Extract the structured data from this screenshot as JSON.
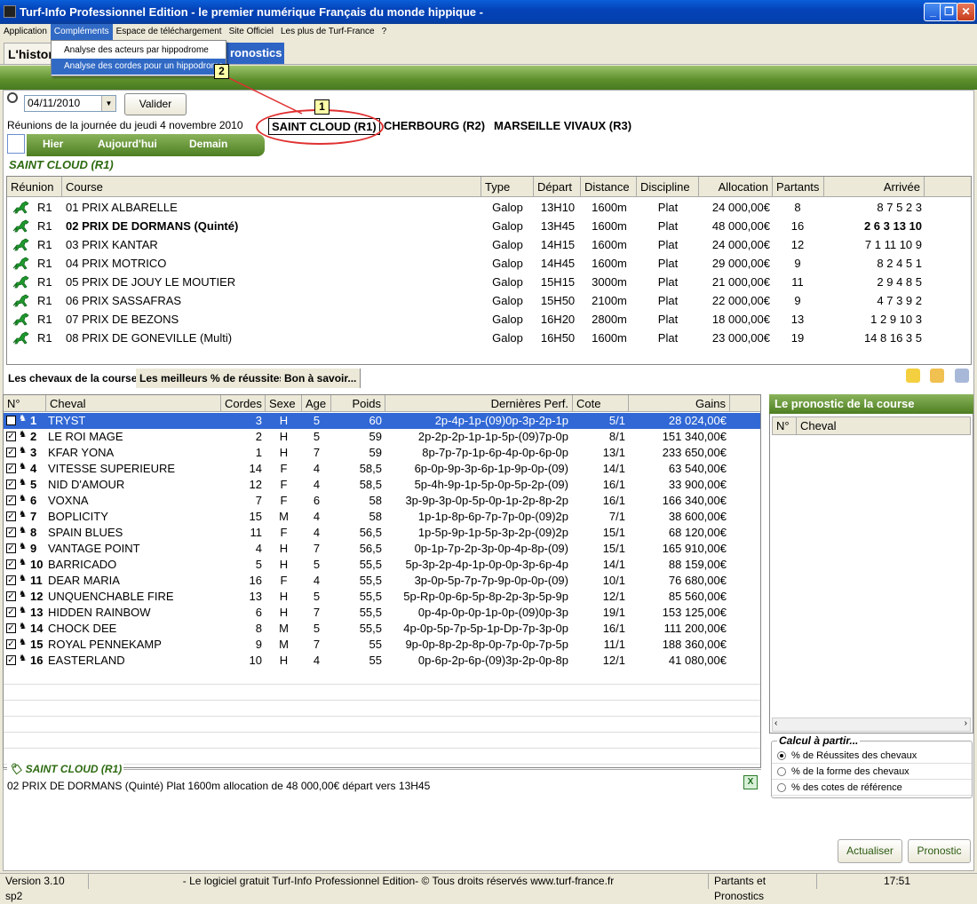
{
  "window": {
    "title": "Turf-Info Professionnel Edition - le premier numérique Français du monde hippique -"
  },
  "menu": [
    "Application",
    "Compléments",
    "Espace de téléchargement",
    "Site Officiel",
    "Les plus de Turf-France",
    "?"
  ],
  "dropdown": [
    "Analyse des acteurs par hippodrome",
    "Analyse des cordes pour un hippodrome"
  ],
  "tabs": {
    "hist": "L'histori",
    "prono": "ronostics"
  },
  "callouts": [
    "1",
    "2"
  ],
  "date": {
    "value": "04/11/2010",
    "valider": "Valider",
    "label": "Réunions de la journée du jeudi 4 novembre 2010"
  },
  "meetings": [
    "SAINT CLOUD (R1)",
    "CHERBOURG (R2)",
    "MARSEILLE VIVAUX (R3)"
  ],
  "daynav": [
    "Hier",
    "Aujourd'hui",
    "Demain"
  ],
  "meeting_title": "SAINT CLOUD (R1)",
  "race_headers": [
    "Réunion",
    "Course",
    "Type",
    "Départ",
    "Distance",
    "Discipline",
    "Allocation",
    "Partants",
    "Arrivée"
  ],
  "races": [
    [
      "R1",
      "01 PRIX ALBARELLE",
      "Galop",
      "13H10",
      "1600m",
      "Plat",
      "24 000,00€",
      "8",
      "8 7 5 2 3"
    ],
    [
      "R1",
      "02 PRIX DE DORMANS (Quinté)",
      "Galop",
      "13H45",
      "1600m",
      "Plat",
      "48 000,00€",
      "16",
      "2 6 3 13 10"
    ],
    [
      "R1",
      "03 PRIX KANTAR",
      "Galop",
      "14H15",
      "1600m",
      "Plat",
      "24 000,00€",
      "12",
      "7 1 11 10 9"
    ],
    [
      "R1",
      "04 PRIX MOTRICO",
      "Galop",
      "14H45",
      "1600m",
      "Plat",
      "29 000,00€",
      "9",
      "8 2 4 5 1"
    ],
    [
      "R1",
      "05 PRIX DE JOUY LE MOUTIER",
      "Galop",
      "15H15",
      "3000m",
      "Plat",
      "21 000,00€",
      "11",
      "2 9 4 8 5"
    ],
    [
      "R1",
      "06 PRIX SASSAFRAS",
      "Galop",
      "15H50",
      "2100m",
      "Plat",
      "22 000,00€",
      "9",
      "4 7 3 9 2"
    ],
    [
      "R1",
      "07 PRIX DE BEZONS",
      "Galop",
      "16H20",
      "2800m",
      "Plat",
      "18 000,00€",
      "13",
      "1 2 9 10 3"
    ],
    [
      "R1",
      "08 PRIX DE GONEVILLE (Multi)",
      "Galop",
      "16H50",
      "1600m",
      "Plat",
      "23 000,00€",
      "19",
      "14 8 16 3 5"
    ]
  ],
  "subtabs": [
    "Les chevaux de la course",
    "Les meilleurs % de réussites",
    "Bon à savoir..."
  ],
  "horse_headers": [
    "N°",
    "Cheval",
    "Cordes",
    "Sexe",
    "Age",
    "Poids",
    "Dernières Perf.",
    "Cote Ref.",
    "Gains"
  ],
  "horses": [
    [
      "1",
      "TRYST",
      "3",
      "H",
      "5",
      "60",
      "2p-4p-1p-(09)0p-3p-2p-1p",
      "5/1",
      "28 024,00€"
    ],
    [
      "2",
      "LE ROI MAGE",
      "2",
      "H",
      "5",
      "59",
      "2p-2p-2p-1p-1p-5p-(09)7p-0p",
      "8/1",
      "151 340,00€"
    ],
    [
      "3",
      "KFAR YONA",
      "1",
      "H",
      "7",
      "59",
      "8p-7p-7p-1p-6p-4p-0p-6p-0p",
      "13/1",
      "233 650,00€"
    ],
    [
      "4",
      "VITESSE SUPERIEURE",
      "14",
      "F",
      "4",
      "58,5",
      "6p-0p-9p-3p-6p-1p-9p-0p-(09)",
      "14/1",
      "63 540,00€"
    ],
    [
      "5",
      "NID D'AMOUR",
      "12",
      "F",
      "4",
      "58,5",
      "5p-4h-9p-1p-5p-0p-5p-2p-(09)",
      "16/1",
      "33 900,00€"
    ],
    [
      "6",
      "VOXNA",
      "7",
      "F",
      "6",
      "58",
      "3p-9p-3p-0p-5p-0p-1p-2p-8p-2p",
      "16/1",
      "166 340,00€"
    ],
    [
      "7",
      "BOPLICITY",
      "15",
      "M",
      "4",
      "58",
      "1p-1p-8p-6p-7p-7p-0p-(09)2p",
      "7/1",
      "38 600,00€"
    ],
    [
      "8",
      "SPAIN BLUES",
      "11",
      "F",
      "4",
      "56,5",
      "1p-5p-9p-1p-5p-3p-2p-(09)2p",
      "15/1",
      "68 120,00€"
    ],
    [
      "9",
      "VANTAGE POINT",
      "4",
      "H",
      "7",
      "56,5",
      "0p-1p-7p-2p-3p-0p-4p-8p-(09)",
      "15/1",
      "165 910,00€"
    ],
    [
      "10",
      "BARRICADO",
      "5",
      "H",
      "5",
      "55,5",
      "5p-3p-2p-4p-1p-0p-0p-3p-6p-4p",
      "14/1",
      "88 159,00€"
    ],
    [
      "11",
      "DEAR MARIA",
      "16",
      "F",
      "4",
      "55,5",
      "3p-0p-5p-7p-7p-9p-0p-0p-(09)",
      "10/1",
      "76 680,00€"
    ],
    [
      "12",
      "UNQUENCHABLE FIRE",
      "13",
      "H",
      "5",
      "55,5",
      "5p-Rp-0p-6p-5p-8p-2p-3p-5p-9p",
      "12/1",
      "85 560,00€"
    ],
    [
      "13",
      "HIDDEN RAINBOW",
      "6",
      "H",
      "7",
      "55,5",
      "0p-4p-0p-0p-1p-0p-(09)0p-3p",
      "19/1",
      "153 125,00€"
    ],
    [
      "14",
      "CHOCK DEE",
      "8",
      "M",
      "5",
      "55,5",
      "4p-0p-5p-7p-5p-1p-Dp-7p-3p-0p",
      "16/1",
      "111 200,00€"
    ],
    [
      "15",
      "ROYAL PENNEKAMP",
      "9",
      "M",
      "7",
      "55",
      "9p-0p-8p-2p-8p-0p-7p-0p-7p-5p",
      "11/1",
      "188 360,00€"
    ],
    [
      "16",
      "EASTERLAND",
      "10",
      "H",
      "4",
      "55",
      "0p-6p-2p-6p-(09)3p-2p-0p-8p",
      "12/1",
      "41 080,00€"
    ]
  ],
  "info": {
    "legend": "SAINT CLOUD (R1)",
    "text": "02 PRIX DE DORMANS (Quinté) Plat 1600m allocation de 48 000,00€ départ vers 13H45"
  },
  "prono": {
    "title": "Le pronostic de la course",
    "col_no": "N°",
    "col_cheval": "Cheval",
    "calc_legend": "Calcul à partir...",
    "options": [
      "% de Réussites des chevaux",
      "% de la forme des chevaux",
      "% des cotes de référence"
    ],
    "actualiser": "Actualiser",
    "pronostic": "Pronostic"
  },
  "status": {
    "version": "Version 3.10 sp2",
    "copyright": "- Le logiciel gratuit Turf-Info Professionnel Edition- © Tous droits réservés www.turf-france.fr",
    "mode": "Partants et Pronostics",
    "time": "17:51"
  },
  "colors": {
    "accent_green": "#5c8e2c",
    "selection_blue": "#3168d5",
    "callout_red": "#e03030"
  }
}
